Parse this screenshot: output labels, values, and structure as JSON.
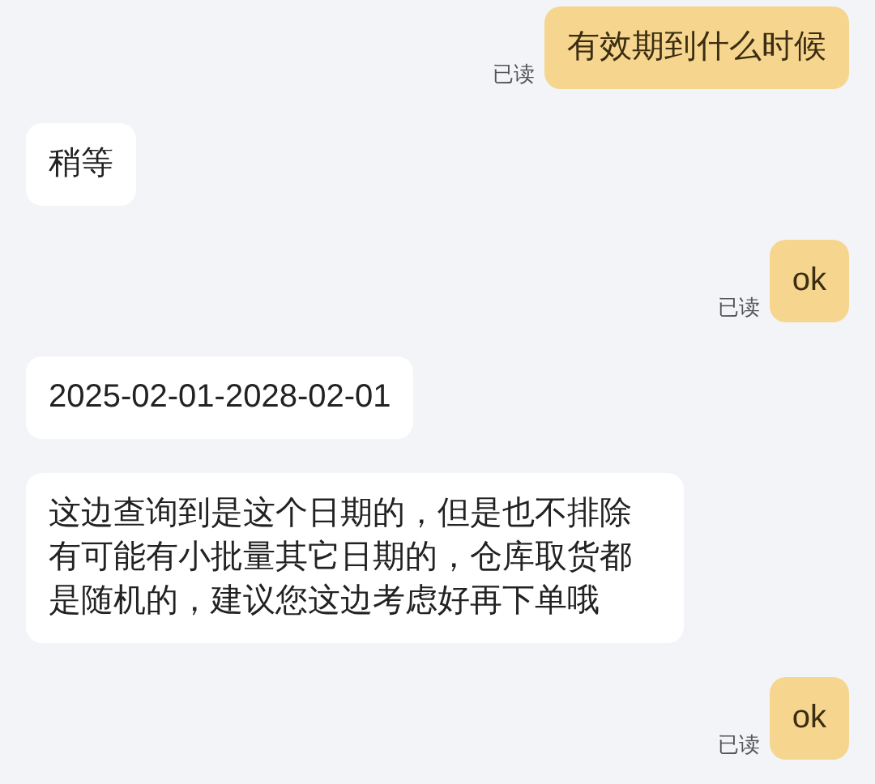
{
  "messages": [
    {
      "kind": "outgoing",
      "text": "有效期到什么时候",
      "status": "已读"
    },
    {
      "kind": "incoming",
      "text": "稍等"
    },
    {
      "kind": "outgoing",
      "text": "ok",
      "status": "已读"
    },
    {
      "kind": "incoming",
      "text": "2025-02-01-2028-02-01"
    },
    {
      "kind": "incoming",
      "text": "这边查询到是这个日期的，但是也不排除有可能有小批量其它日期的，仓库取货都是随机的，建议您这边考虑好再下单哦"
    },
    {
      "kind": "outgoing",
      "text": "ok",
      "status": "已读"
    }
  ]
}
